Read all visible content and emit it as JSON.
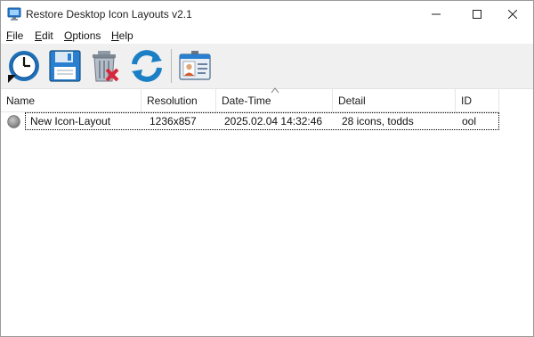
{
  "window": {
    "title": "Restore Desktop Icon Layouts v2.1",
    "app_icon": "monitor-icon",
    "controls": [
      "minimize-icon",
      "maximize-icon",
      "close-icon"
    ]
  },
  "menu": {
    "items": [
      {
        "label": "File",
        "accel": "F",
        "rest": "ile"
      },
      {
        "label": "Edit",
        "accel": "E",
        "rest": "dit"
      },
      {
        "label": "Options",
        "accel": "O",
        "rest": "ptions"
      },
      {
        "label": "Help",
        "accel": "H",
        "rest": "elp"
      }
    ]
  },
  "toolbar": {
    "buttons": [
      "restore-clock-icon",
      "save-disk-icon",
      "delete-trash-icon",
      "refresh-icon",
      "id-card-icon"
    ]
  },
  "table": {
    "columns": [
      "Name",
      "Resolution",
      "Date-Time",
      "Detail",
      "ID"
    ],
    "sorted_column": "Date-Time",
    "rows": [
      {
        "status_icon": "gray-circle-icon",
        "name": "New Icon-Layout",
        "resolution": "1236x857",
        "datetime": "2025.02.04 14:32:46",
        "detail": "28 icons, todds",
        "id": "ool"
      }
    ]
  },
  "colors": {
    "toolbar_bg": "#f0f0f0",
    "accent_blue": "#1e6fb8",
    "delete_red": "#d9263a",
    "refresh_blue": "#1a7fc4"
  }
}
